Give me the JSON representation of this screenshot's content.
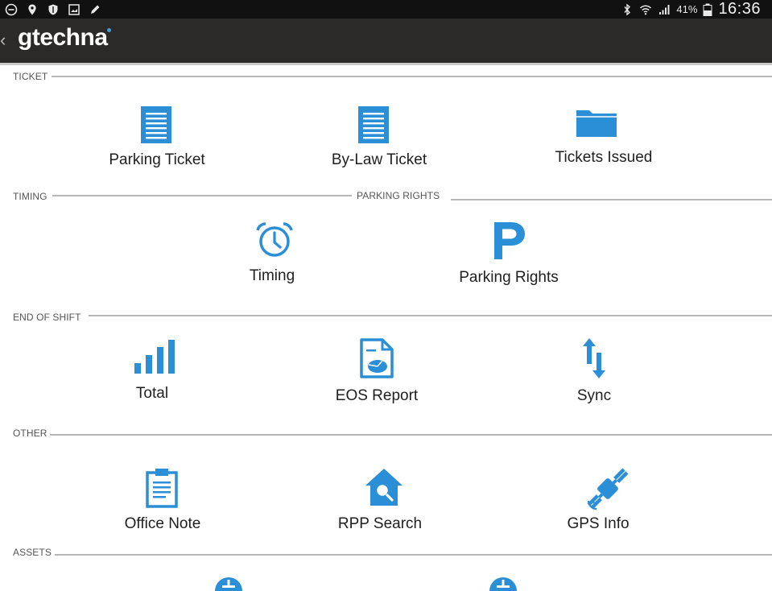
{
  "status_bar": {
    "battery_percent": "41%",
    "time": "16:36"
  },
  "app_bar": {
    "title": "gtechna"
  },
  "sections": {
    "ticket": "TICKET",
    "timing": "TIMING",
    "parking_rights": "PARKING RIGHTS",
    "end_of_shift": "END OF SHIFT",
    "other": "OTHER",
    "assets": "ASSETS"
  },
  "tiles": {
    "parking_ticket": "Parking Ticket",
    "bylaw_ticket": "By-Law Ticket",
    "tickets_issued": "Tickets Issued",
    "timing": "Timing",
    "parking_rights": "Parking Rights",
    "total": "Total",
    "eos_report": "EOS Report",
    "sync": "Sync",
    "office_note": "Office Note",
    "rpp_search": "RPP Search",
    "gps_info": "GPS Info"
  },
  "colors": {
    "accent": "#2a8fd6",
    "status_bar": "#111111",
    "app_bar": "#2b2a28"
  },
  "icons": {
    "parking_ticket": "document-lines-icon",
    "bylaw_ticket": "document-lines-icon",
    "tickets_issued": "folder-icon",
    "timing": "alarm-clock-icon",
    "parking_rights": "letter-p-icon",
    "total": "bar-chart-icon",
    "eos_report": "report-chart-icon",
    "sync": "sync-arrows-icon",
    "office_note": "clipboard-icon",
    "rpp_search": "house-search-icon",
    "gps_info": "satellite-icon"
  }
}
